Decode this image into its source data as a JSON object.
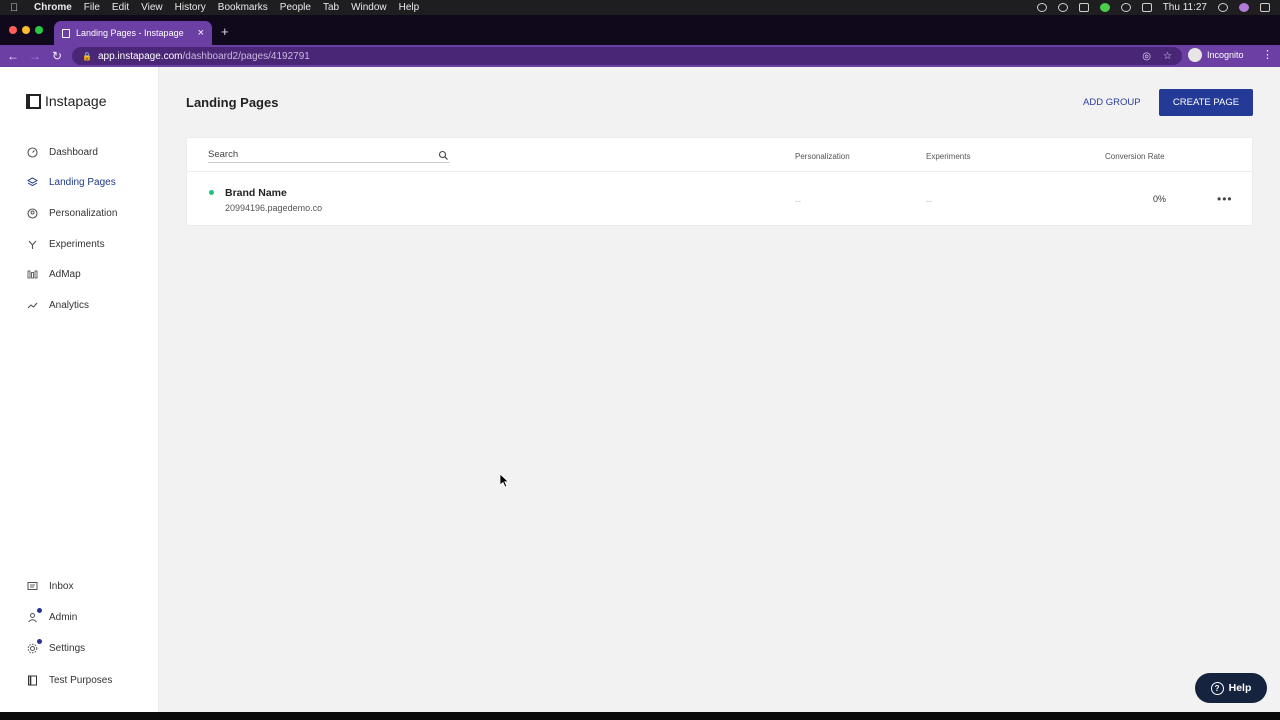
{
  "menubar": {
    "app": "Chrome",
    "items": [
      "File",
      "Edit",
      "View",
      "History",
      "Bookmarks",
      "People",
      "Tab",
      "Window",
      "Help"
    ],
    "clock": "Thu 11:27"
  },
  "browser": {
    "tab_title": "Landing Pages - Instapage",
    "url_host": "app.instapage.com",
    "url_path": "/dashboard2/pages/4192791",
    "profile_label": "Incognito"
  },
  "sidebar": {
    "logo": "Instapage",
    "items": [
      {
        "label": "Dashboard"
      },
      {
        "label": "Landing Pages"
      },
      {
        "label": "Personalization"
      },
      {
        "label": "Experiments"
      },
      {
        "label": "AdMap"
      },
      {
        "label": "Analytics"
      }
    ],
    "bottom_items": [
      {
        "label": "Inbox"
      },
      {
        "label": "Admin"
      },
      {
        "label": "Settings"
      },
      {
        "label": "Test Purposes"
      }
    ]
  },
  "main": {
    "title": "Landing Pages",
    "add_group": "ADD GROUP",
    "create_page": "CREATE PAGE",
    "search_placeholder": "Search",
    "columns": [
      "Personalization",
      "Experiments",
      "Conversion Rate"
    ],
    "rows": [
      {
        "name": "Brand Name",
        "url": "20994196.pagedemo.co",
        "personalization": "--",
        "experiments": "--",
        "conversion_rate": "0%"
      }
    ]
  },
  "help": {
    "label": "Help"
  },
  "colors": {
    "accent": "#233a97",
    "browser_purple": "#6b3fa3",
    "status_green": "#1fbf7c"
  }
}
